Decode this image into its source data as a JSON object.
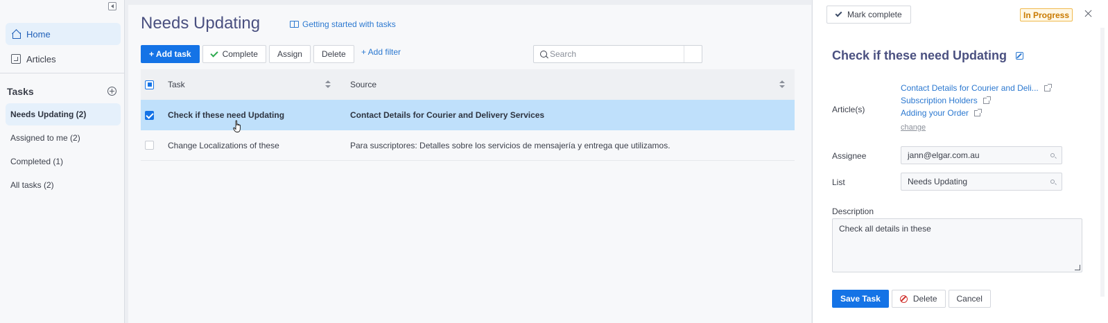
{
  "sidebar": {
    "nav": [
      {
        "label": "Home",
        "icon": "home-icon"
      },
      {
        "label": "Articles",
        "icon": "article-icon"
      }
    ],
    "tasks_heading": "Tasks",
    "lists": [
      {
        "label": "Needs Updating (2)",
        "active": true
      },
      {
        "label": "Assigned to me (2)",
        "active": false
      },
      {
        "label": "Completed (1)",
        "active": false
      },
      {
        "label": "All tasks (2)",
        "active": false
      }
    ]
  },
  "main": {
    "title": "Needs Updating",
    "guide_link": "Getting started with tasks",
    "toolbar": {
      "add_task": "+ Add task",
      "complete": "Complete",
      "assign": "Assign",
      "delete": "Delete",
      "add_filter": "+ Add filter"
    },
    "search": {
      "placeholder": "Search",
      "value": ""
    },
    "table": {
      "columns": [
        "Task",
        "Source"
      ],
      "rows": [
        {
          "task": "Check if these need Updating",
          "source": "Contact Details for Courier and Delivery Services",
          "selected": true
        },
        {
          "task": "Change Localizations of these",
          "source": "Para suscriptores: Detalles sobre los servicios de mensajería y entrega que utilizamos.",
          "selected": false
        }
      ]
    }
  },
  "panel": {
    "mark_complete": "Mark complete",
    "status": "In Progress",
    "task_title": "Check if these need Updating",
    "labels": {
      "articles": "Article(s)",
      "assignee": "Assignee",
      "list": "List",
      "description": "Description"
    },
    "articles": [
      "Contact Details for Courier and Deli...",
      "Subscription Holders",
      "Adding your Order"
    ],
    "change_link": "change",
    "assignee": "jann@elgar.com.au",
    "list": "Needs Updating",
    "description": "Check all details in these",
    "buttons": {
      "save": "Save Task",
      "delete": "Delete",
      "cancel": "Cancel"
    }
  },
  "colors": {
    "accent": "#1473e6",
    "selected_row": "#bfe0fb",
    "status_badge": "#f0b94d",
    "title": "#4a5080"
  }
}
